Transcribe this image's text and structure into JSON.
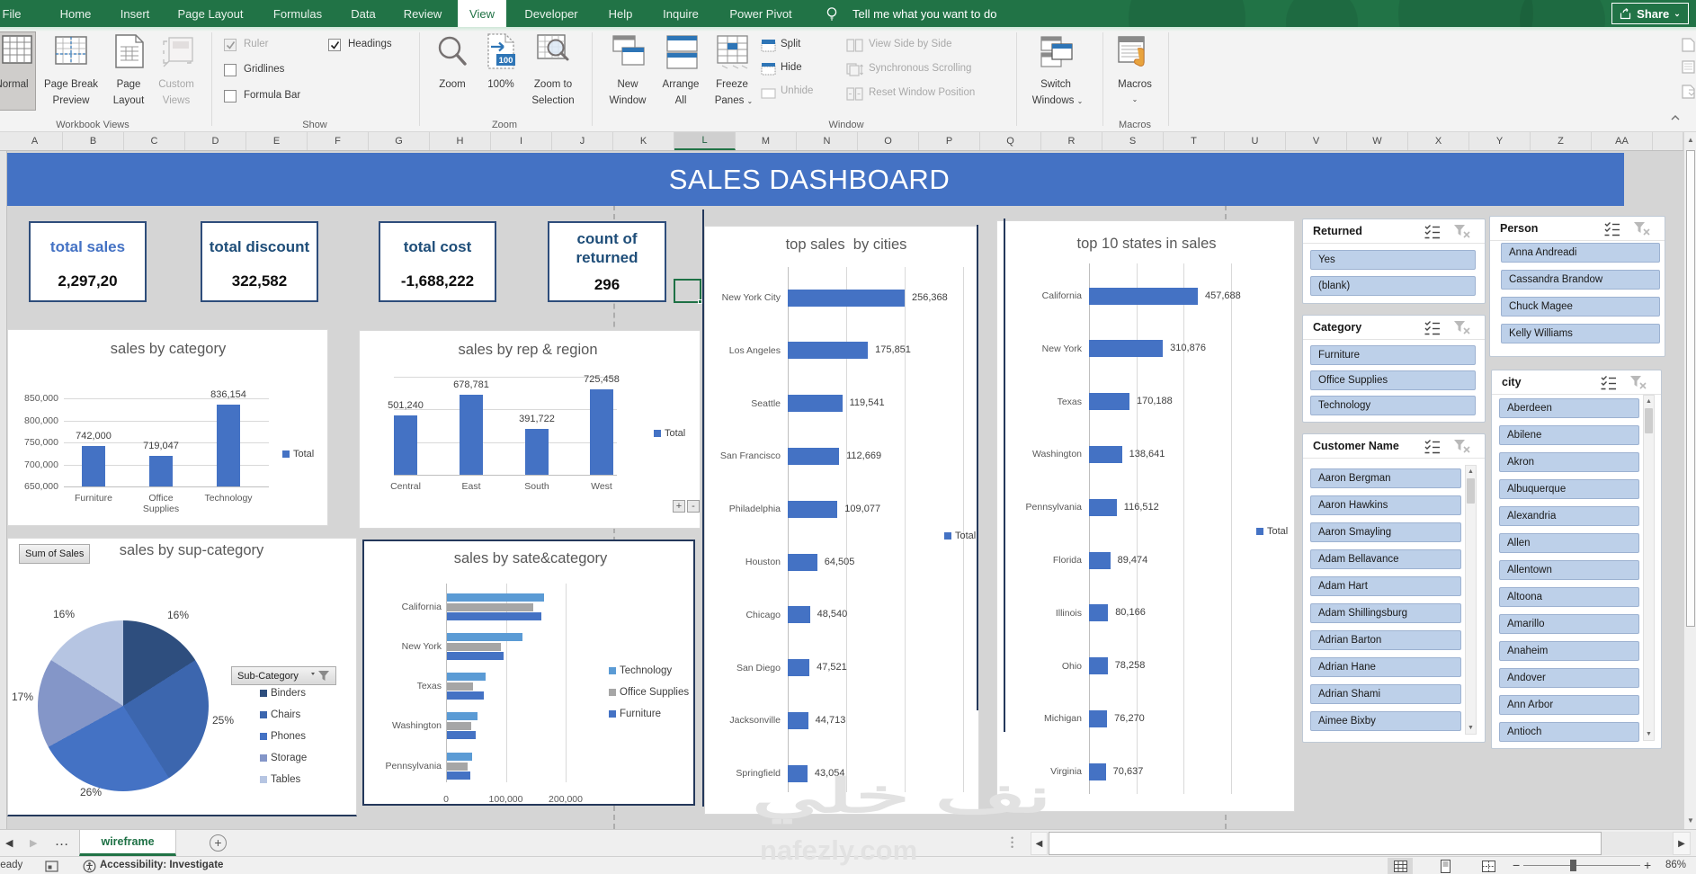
{
  "menubar": {
    "tabs": [
      {
        "label": "File",
        "active": false
      },
      {
        "label": "Home",
        "active": false
      },
      {
        "label": "Insert",
        "active": false
      },
      {
        "label": "Page Layout",
        "active": false
      },
      {
        "label": "Formulas",
        "active": false
      },
      {
        "label": "Data",
        "active": false
      },
      {
        "label": "Review",
        "active": false
      },
      {
        "label": "View",
        "active": true
      },
      {
        "label": "Developer",
        "active": false
      },
      {
        "label": "Help",
        "active": false
      },
      {
        "label": "Inquire",
        "active": false
      },
      {
        "label": "Power Pivot",
        "active": false
      }
    ],
    "tellme": "Tell me what you want to do",
    "share": "Share"
  },
  "ribbon": {
    "groups": [
      "Workbook Views",
      "Show",
      "Zoom",
      "Window",
      "Macros"
    ],
    "workbook_views": {
      "normal": "Normal",
      "page_break_preview": [
        "Page Break",
        "Preview"
      ],
      "page_layout": [
        "Page",
        "Layout"
      ],
      "custom_views": [
        "Custom",
        "Views"
      ]
    },
    "show": {
      "ruler": {
        "label": "Ruler",
        "checked": true,
        "disabled": true
      },
      "gridlines": {
        "label": "Gridlines",
        "checked": false,
        "disabled": false
      },
      "formula_bar": {
        "label": "Formula Bar",
        "checked": false,
        "disabled": false
      },
      "headings": {
        "label": "Headings",
        "checked": true,
        "disabled": false
      }
    },
    "zoom": {
      "zoom": "Zoom",
      "hundred": "100%",
      "zoom_to_selection": [
        "Zoom to",
        "Selection"
      ]
    },
    "window": {
      "new_window": [
        "New",
        "Window"
      ],
      "arrange_all": [
        "Arrange",
        "All"
      ],
      "freeze_panes": [
        "Freeze",
        "Panes"
      ],
      "split": "Split",
      "hide": "Hide",
      "unhide": "Unhide",
      "view_side_by_side": "View Side by Side",
      "synchronous_scrolling": "Synchronous Scrolling",
      "reset_window_position": "Reset Window Position",
      "switch_windows": [
        "Switch",
        "Windows"
      ]
    },
    "macros": {
      "label": "Macros"
    }
  },
  "grid": {
    "columns": [
      "A",
      "B",
      "C",
      "D",
      "E",
      "F",
      "G",
      "H",
      "I",
      "J",
      "K",
      "L",
      "M",
      "N",
      "O",
      "P",
      "Q",
      "R",
      "S",
      "T",
      "U",
      "V",
      "W",
      "X",
      "Y",
      "Z",
      "AA"
    ],
    "selected_column": "L"
  },
  "banner": {
    "title": "SALES DASHBOARD"
  },
  "kpis": [
    {
      "label": "total sales",
      "value": "2,297,20",
      "label_color": "#4472C4"
    },
    {
      "label": "total discount",
      "value": "322,582",
      "label_color": "#1F4E79"
    },
    {
      "label": "total cost",
      "value": "-1,688,222",
      "label_color": "#1F4E79"
    },
    {
      "label": "count of returned",
      "label_lines": [
        "count of",
        "returned"
      ],
      "value": "296",
      "label_color": "#1F4E79"
    }
  ],
  "chart_data": [
    {
      "id": "sales_by_category",
      "type": "bar",
      "title": "sales by category",
      "categories": [
        "Furniture",
        "Office Supplies",
        "Technology"
      ],
      "values": [
        742000,
        719047,
        836154
      ],
      "value_labels": [
        "742,000",
        "719,047",
        "836,154"
      ],
      "yticks": [
        "850,000",
        "800,000",
        "750,000",
        "700,000",
        "650,000"
      ],
      "ylim": [
        650000,
        850000
      ],
      "legend": [
        "Total"
      ],
      "legend_color": "#4472C4"
    },
    {
      "id": "sales_by_rep_region",
      "type": "bar",
      "title": "sales by rep & region",
      "categories": [
        "Central",
        "East",
        "South",
        "West"
      ],
      "values": [
        501240,
        678781,
        391722,
        725458
      ],
      "value_labels": [
        "501,240",
        "678,781",
        "391,722",
        "725,458"
      ],
      "ylim": [
        0,
        830000
      ],
      "legend": [
        "Total"
      ],
      "legend_color": "#4472C4",
      "buttons": [
        "+",
        "-"
      ]
    },
    {
      "id": "sales_by_sub_category",
      "type": "pie",
      "title": "sales by sup-category",
      "field_button": "Sum of Sales",
      "legend_button": "Sub-Category",
      "labels": [
        "Binders",
        "Chairs",
        "Phones",
        "Storage",
        "Tables"
      ],
      "values": [
        16,
        25,
        26,
        17,
        16
      ],
      "value_labels": [
        "16%",
        "25%",
        "26%",
        "17%",
        "16%"
      ],
      "colors": [
        "#2E4E7E",
        "#3C66AE",
        "#4472C4",
        "#8496C8",
        "#B6C5E2"
      ]
    },
    {
      "id": "sales_by_state_category",
      "type": "hbar_clustered",
      "title": "sales by sate&category",
      "categories": [
        "California",
        "New York",
        "Texas",
        "Washington",
        "Pennsylvania"
      ],
      "series": [
        {
          "name": "Technology",
          "color": "#5B9BD5",
          "values": [
            163000,
            127000,
            65000,
            51000,
            42000
          ]
        },
        {
          "name": "Office Supplies",
          "color": "#A6A6A6",
          "values": [
            145000,
            90000,
            43000,
            41000,
            35000
          ]
        },
        {
          "name": "Furniture",
          "color": "#4472C4",
          "values": [
            158000,
            94000,
            61000,
            48000,
            39000
          ]
        }
      ],
      "xticks": [
        "0",
        "100,000",
        "200,000"
      ],
      "xlim": [
        0,
        200000
      ]
    },
    {
      "id": "top_sales_by_cities",
      "type": "hbar",
      "title": "top sales  by cities",
      "categories": [
        "New York City",
        "Los Angeles",
        "Seattle",
        "San Francisco",
        "Philadelphia",
        "Houston",
        "Chicago",
        "San Diego",
        "Jacksonville",
        "Springfield"
      ],
      "values": [
        256368,
        175851,
        119541,
        112669,
        109077,
        64505,
        48540,
        47521,
        44713,
        43054
      ],
      "value_labels": [
        "256,368",
        "175,851",
        "119,541",
        "112,669",
        "109,077",
        "64,505",
        "48,540",
        "47,521",
        "44,713",
        "43,054"
      ],
      "legend": [
        "Total"
      ],
      "legend_color": "#4472C4"
    },
    {
      "id": "top_10_states_in_sales",
      "type": "hbar",
      "title": "top 10 states in sales",
      "categories": [
        "California",
        "New York",
        "Texas",
        "Washington",
        "Pennsylvania",
        "Florida",
        "Illinois",
        "Ohio",
        "Michigan",
        "Virginia"
      ],
      "values": [
        457688,
        310876,
        170188,
        138641,
        116512,
        89474,
        80166,
        78258,
        76270,
        70637
      ],
      "value_labels": [
        "457,688",
        "310,876",
        "170,188",
        "138,641",
        "116,512",
        "89,474",
        "80,166",
        "78,258",
        "76,270",
        "70,637"
      ],
      "legend": [
        "Total"
      ],
      "legend_color": "#4472C4"
    }
  ],
  "slicers": [
    {
      "title": "Returned",
      "items": [
        "Yes",
        "(blank)"
      ],
      "scrollbar": false
    },
    {
      "title": "Category",
      "items": [
        "Furniture",
        "Office Supplies",
        "Technology"
      ],
      "scrollbar": false
    },
    {
      "title": "Customer Name",
      "items": [
        "Aaron Bergman",
        "Aaron Hawkins",
        "Aaron Smayling",
        "Adam Bellavance",
        "Adam Hart",
        "Adam Shillingsburg",
        "Adrian Barton",
        "Adrian Hane",
        "Adrian Shami",
        "Aimee Bixby"
      ],
      "scrollbar": true
    },
    {
      "title": "Person",
      "items": [
        "Anna Andreadi",
        "Cassandra Brandow",
        "Chuck Magee",
        "Kelly Williams"
      ],
      "scrollbar": false
    },
    {
      "title": "city",
      "items": [
        "Aberdeen",
        "Abilene",
        "Akron",
        "Albuquerque",
        "Alexandria",
        "Allen",
        "Allentown",
        "Altoona",
        "Amarillo",
        "Anaheim",
        "Andover",
        "Ann Arbor",
        "Antioch"
      ],
      "scrollbar": true
    }
  ],
  "sheet_tabs": {
    "active": "wireframe",
    "ellipsis": "...",
    "add": "+"
  },
  "status_bar": {
    "ready": "Ready",
    "accessibility": "Accessibility: Investigate",
    "zoom_level": "86%"
  },
  "watermark": {
    "line1": "نف خلي",
    "line2": "nafezly.com"
  }
}
